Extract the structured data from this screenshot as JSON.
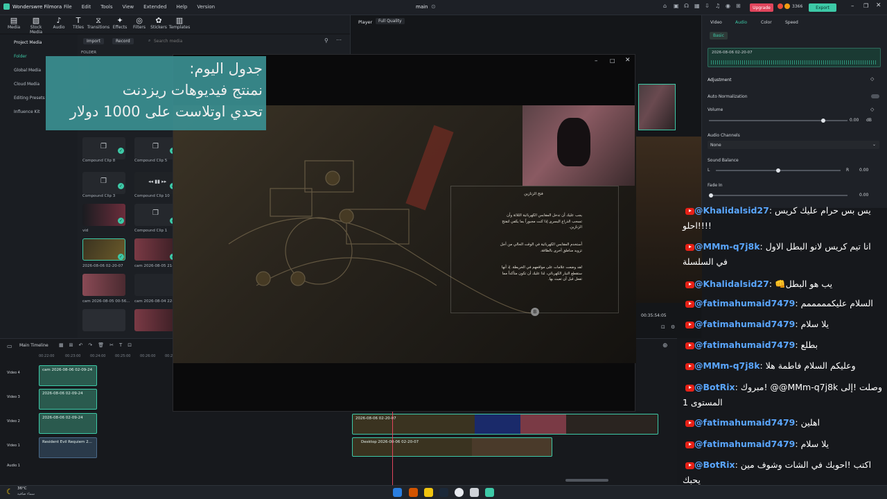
{
  "app": {
    "name": "Wonderswre Filmora",
    "menu": [
      "File",
      "Edit",
      "Tools",
      "View",
      "Extended",
      "Help",
      "Version"
    ],
    "project_title": "main",
    "upgrade_label": "Upgrade",
    "credits": "3366",
    "export_label": "Export"
  },
  "tools": [
    {
      "label": "Media",
      "icon": "media-icon"
    },
    {
      "label": "Stock Media",
      "icon": "stock-icon"
    },
    {
      "label": "Audio",
      "icon": "audio-icon"
    },
    {
      "label": "Titles",
      "icon": "titles-icon"
    },
    {
      "label": "Transitions",
      "icon": "transitions-icon"
    },
    {
      "label": "Effects",
      "icon": "effects-icon"
    },
    {
      "label": "Filters",
      "icon": "filters-icon"
    },
    {
      "label": "Stickers",
      "icon": "stickers-icon"
    },
    {
      "label": "Templates",
      "icon": "templates-icon"
    }
  ],
  "sidebar": {
    "items": [
      "Project Media",
      "Folder",
      "Global Media",
      "Cloud Media",
      "Editing Presets",
      "Influence Kit"
    ]
  },
  "media": {
    "import_label": "Import",
    "record_label": "Record",
    "search_placeholder": "Search media",
    "folder_label": "FOLDER",
    "clips": [
      "Compound Clip 8",
      "Compound Clip 5",
      "Compound Clip 3",
      "Compound Clip 10",
      "vid",
      "Compound Clip 1",
      "2026-08-06 02-20-07",
      "cam 2026-08-05 21-1",
      "cam 2026-08-05 00-56...",
      "cam 2026-08-04 22-16-08"
    ]
  },
  "player": {
    "label": "Player",
    "quality": "Full Quality",
    "timecode": "00:35:54:05"
  },
  "props": {
    "tabs": [
      "Video",
      "Audio",
      "Color",
      "Speed"
    ],
    "active_tab": "Audio",
    "basic_label": "Basic",
    "clip_name": "2026-08-06 02-20-07",
    "adjustment": "Adjustment",
    "auto_normalization": "Auto Normalization",
    "volume_label": "Volume",
    "volume_value": "0.00",
    "volume_unit": "dB",
    "channels_label": "Audio Channels",
    "channels_value": "None",
    "balance_label": "Sound Balance",
    "balance_left": "L",
    "balance_right": "R",
    "balance_value": "0.00",
    "fade_label": "Fade In",
    "fade_value": "0.00"
  },
  "overlay": {
    "line1": "جدول اليوم:",
    "line2": "نمنتج فيديوهات ريزدنت",
    "line3": "تحدي اوتلاست على 1000 دولار"
  },
  "game_panel": {
    "title": "فتح الزنازين",
    "para1": "يجب عليك أن تدخل المقابس الكهربائية الثلاثة وأن تسحب الذراع اليسرى إذا كنت مجبوراً بما يكفي لتفتح الزنازين.",
    "para2": "أستخدم المقابس الكهربائية في الوقت الحالي من أجل تزويد مناطق أخرى بالطاقة.",
    "para3": "لقد وضعت علامات على مواقعهم في الخريطة. إذ أنها ستقطع التيار الكهربائي، لذا عليك أن تكون متأكداً مما تفعل قبل أن تعبث بها.",
    "button_glyph": "B"
  },
  "chat": [
    {
      "user": "@Khalidalsid27",
      "msg": "يس بس حرام عليك كريس !!!!احلو"
    },
    {
      "user": "@MMm-q7j8k",
      "msg": "انا تيم كريس لانو البطل الاول في السلسلة"
    },
    {
      "user": "@Khalidalsid27",
      "msg": "👊يب هو البطل"
    },
    {
      "user": "@fatimahumaid7479",
      "msg": "السلام عليكمممممم"
    },
    {
      "user": "@fatimahumaid7479",
      "msg": "يلا سلام"
    },
    {
      "user": "@fatimahumaid7479",
      "msg": "بطلع"
    },
    {
      "user": "@MMm-q7j8k",
      "msg": "وعليكم السلام فاطمة هلا"
    },
    {
      "user": "@BotRix",
      "msg": "مبروك! @@MMm-q7j8k وصلت !إلى المستوى 1"
    },
    {
      "user": "@fatimahumaid7479",
      "msg": "اهلين"
    },
    {
      "user": "@fatimahumaid7479",
      "msg": "يلا سلام"
    },
    {
      "user": "@BotRix",
      "msg": "اكتب !احوبك في الشات وشوف مين يحبك"
    }
  ],
  "timeline": {
    "label": "Main Timeline",
    "ruler": [
      "00:22:00",
      "00:23:00",
      "00:24:00",
      "00:25:00",
      "00:26:00",
      "00:27:00"
    ],
    "tracks": [
      "Video 4",
      "Video 3",
      "Video 2",
      "Video 1",
      "Audio 1"
    ],
    "clips": [
      "cam 2026-08-06 02-09-24",
      "2026-08-06 02-09-24",
      "2026-08-06 02-09-24",
      "Resident Evil Requiem 2...",
      "2026-08-06 02-20-07",
      "Desktop 2026-08-06 02-20-07"
    ]
  },
  "taskbar": {
    "weather_temp": "36°C",
    "weather_desc": "سماء صافية"
  },
  "colors": {
    "accent": "#3dc9a7",
    "upgrade": "#e0455c",
    "export": "#3dc9a7",
    "chat_user": "#5aa6ff",
    "overlay_bg": "#3a8e90"
  }
}
